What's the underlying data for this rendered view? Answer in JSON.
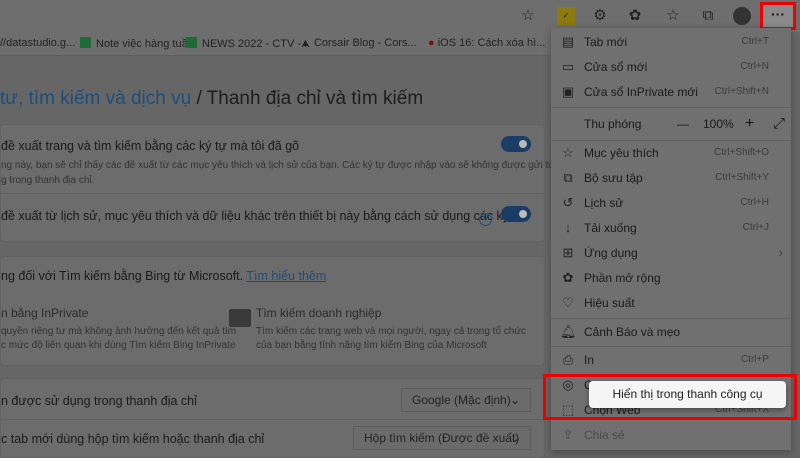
{
  "toolbar": {
    "more_label": "···"
  },
  "bookmarks": [
    {
      "label": "//datastudio.g..."
    },
    {
      "label": "Note việc hàng tuầ..."
    },
    {
      "label": "NEWS 2022 - CTV -..."
    },
    {
      "label": "Corsair Blog - Cors..."
    },
    {
      "label": "iOS 16: Cách xóa hì..."
    }
  ],
  "page": {
    "breadcrumb_link": "tư, tìm kiếm và dịch vụ",
    "breadcrumb_sep": " / ",
    "title": "Thanh địa chỉ và tìm kiếm",
    "setting1": {
      "title": "đề xuất trang và tìm kiếm bằng các ký tự mà tôi đã gõ",
      "desc1": "ng này, bạn sẽ chỉ thấy các đề xuất từ các mục yêu thích và lịch sử của bạn. Các ký tự được nhập vào sẽ không được gửi tới công",
      "desc2": "g trong thanh địa chỉ.",
      "enabled": true
    },
    "setting2": {
      "title": "đề xuất từ lịch sử, mục yêu thích và dữ liệu khác trên thiết bị này bằng cách sử dụng các ký tự",
      "help": "?",
      "enabled": true
    },
    "bing": {
      "text": "ng đối với Tìm kiếm bằng Bing từ Microsoft.",
      "link": "Tìm hiểu thêm",
      "inprivate_title": "n bằng InPrivate",
      "inprivate_desc1": "quyền riêng tư mà không ảnh hưởng đến kết quả tìm",
      "inprivate_desc2": "c mức độ liên quan khi dùng Tìm kiếm Bing InPrivate",
      "enterprise_title": "Tìm kiếm doanh nghiệp",
      "enterprise_desc1": "Tìm kiếm các trang web và mọi người, ngay cả trong tổ chức",
      "enterprise_desc2": "của bạn bằng tính năng tìm kiếm Bing của Microsoft"
    },
    "engine": {
      "label": "n được sử dụng trong thanh địa chỉ",
      "value": "Google (Mặc định)"
    },
    "newtab": {
      "label": "c tab mới dùng hộp tìm kiếm hoặc thanh địa chỉ",
      "value": "Hộp tìm kiếm (Được đề xuất)"
    }
  },
  "menu": {
    "items": [
      {
        "label": "Tab mới",
        "shortcut": "Ctrl+T"
      },
      {
        "label": "Cửa sổ mới",
        "shortcut": "Ctrl+N"
      },
      {
        "label": "Cửa sổ InPrivate mới",
        "shortcut": "Ctrl+Shift+N"
      },
      {
        "label": "Mục yêu thích",
        "shortcut": "Ctrl+Shift+O"
      },
      {
        "label": "Bộ sưu tập",
        "shortcut": "Ctrl+Shift+Y"
      },
      {
        "label": "Lịch sử",
        "shortcut": "Ctrl+H"
      },
      {
        "label": "Tải xuống",
        "shortcut": "Ctrl+J"
      },
      {
        "label": "Ứng dụng",
        "shortcut": "›"
      },
      {
        "label": "Phần mở rộng",
        "shortcut": ""
      },
      {
        "label": "Hiệu suất",
        "shortcut": ""
      },
      {
        "label": "Cảnh Báo và mẹo",
        "shortcut": ""
      },
      {
        "label": "In",
        "shortcut": "Ctrl+P"
      },
      {
        "label": "C",
        "shortcut": ""
      },
      {
        "label": "Chọn Web",
        "shortcut": "Ctrl+Shift+X"
      },
      {
        "label": "Chia sẻ",
        "shortcut": ""
      }
    ],
    "zoom": {
      "label": "Thu phóng",
      "minus": "—",
      "value": "100%",
      "plus": "+",
      "fullscreen": "⤢"
    }
  },
  "tooltip": {
    "label": "Hiển thị trong thanh công cụ"
  }
}
